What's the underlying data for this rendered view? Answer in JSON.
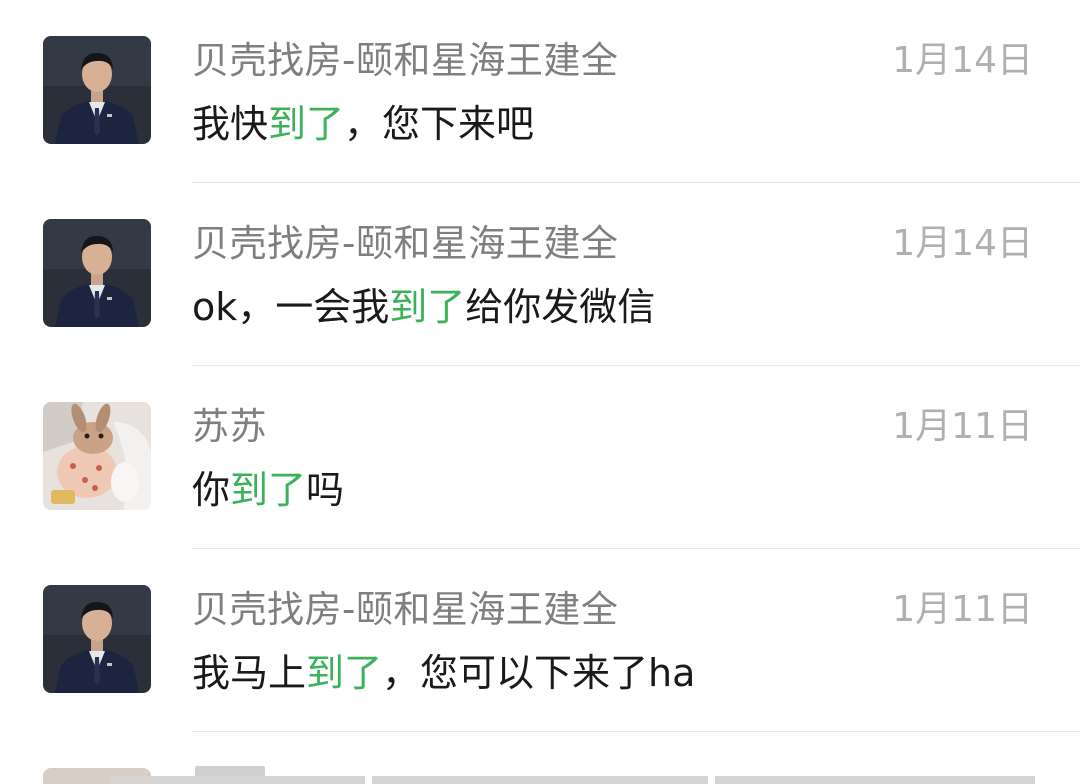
{
  "conversations": [
    {
      "avatar": "agent-portrait-icon",
      "name": "贝壳找房-颐和星海王建全",
      "date": "1月14日",
      "message_pre": "我快",
      "message_highlight": "到了",
      "message_post": "，您下来吧"
    },
    {
      "avatar": "agent-portrait-icon",
      "name": "贝壳找房-颐和星海王建全",
      "date": "1月14日",
      "message_pre": "ok，一会我",
      "message_highlight": "到了",
      "message_post": "给你发微信"
    },
    {
      "avatar": "rabbit-avatar-icon",
      "name": "苏苏",
      "date": "1月11日",
      "message_pre": "你",
      "message_highlight": "到了",
      "message_post": "吗"
    },
    {
      "avatar": "agent-portrait-icon",
      "name": "贝壳找房-颐和星海王建全",
      "date": "1月11日",
      "message_pre": "我马上",
      "message_highlight": "到了",
      "message_post": "，您可以下来了ha"
    }
  ],
  "colors": {
    "highlight": "#3bb25a",
    "name": "#7f7f7f",
    "date": "#b0b0b0",
    "message": "#1a1a1a",
    "divider": "#e6e6e6"
  }
}
